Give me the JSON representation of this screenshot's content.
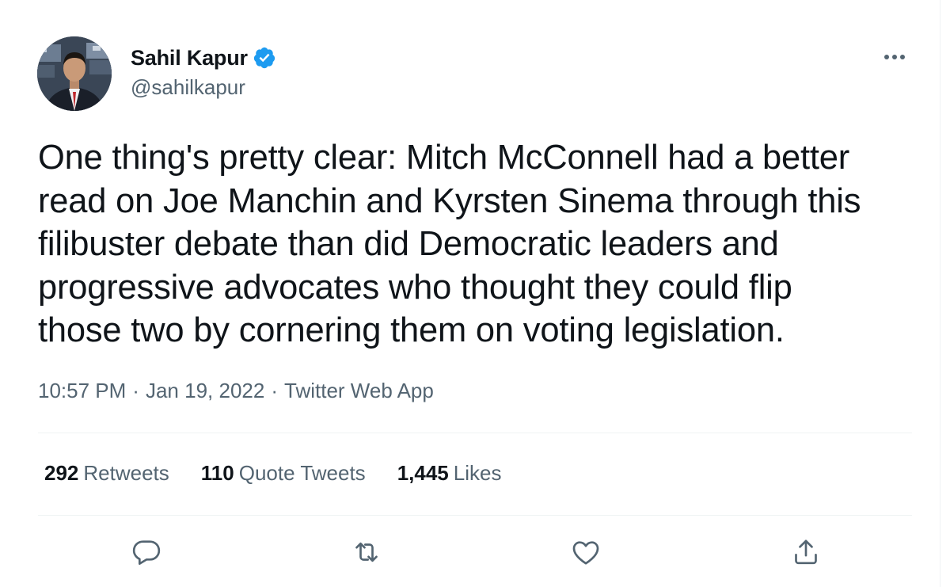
{
  "author": {
    "display_name": "Sahil Kapur",
    "handle": "@sahilkapur",
    "verified": true
  },
  "tweet": {
    "text_lines": [
      "One thing's pretty clear: Mitch McConnell had a better",
      "read on Joe Manchin and Kyrsten Sinema through this",
      "filibuster debate than did Democratic leaders and",
      "progressive advocates who thought they could flip",
      "those two by cornering them on voting legislation."
    ],
    "time": "10:57 PM",
    "date": "Jan 19, 2022",
    "source": "Twitter Web App",
    "separator": "·"
  },
  "stats": {
    "retweets_count": "292",
    "retweets_label": "Retweets",
    "quotes_count": "110",
    "quotes_label": "Quote Tweets",
    "likes_count": "1,445",
    "likes_label": "Likes"
  },
  "actions": {
    "icons": [
      "reply-icon",
      "retweet-icon",
      "like-icon",
      "share-icon"
    ]
  },
  "colors": {
    "text": "#0f1419",
    "secondary": "#536471",
    "divider": "#eff3f4",
    "verified": "#1d9bf0"
  }
}
